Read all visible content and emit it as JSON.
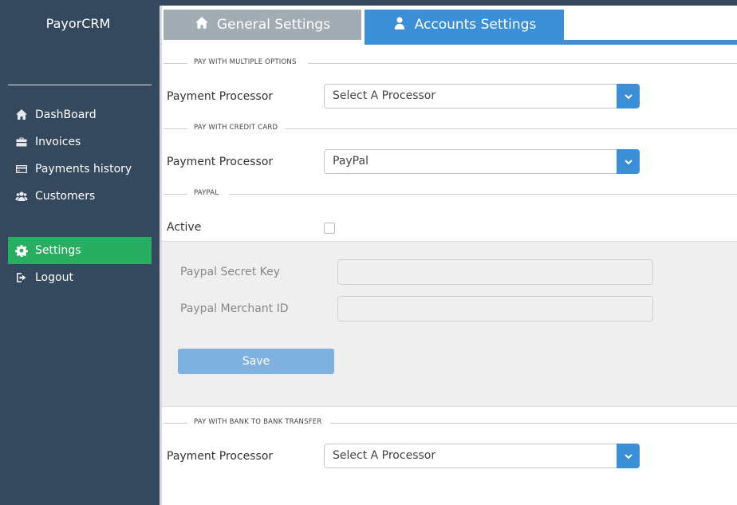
{
  "app": {
    "brand": "PayorCRM"
  },
  "sidebar": {
    "items": [
      {
        "label": "DashBoard",
        "icon": "home-icon"
      },
      {
        "label": "Invoices",
        "icon": "briefcase-icon"
      },
      {
        "label": "Payments history",
        "icon": "credit-card-icon"
      },
      {
        "label": "Customers",
        "icon": "users-icon"
      },
      {
        "label": "Settings",
        "icon": "gear-icon",
        "active": true
      },
      {
        "label": "Logout",
        "icon": "logout-icon"
      }
    ]
  },
  "tabs": [
    {
      "label": "General Settings",
      "icon": "home-icon"
    },
    {
      "label": "Accounts Settings",
      "icon": "user-icon",
      "active": true
    }
  ],
  "sections": {
    "multiple": {
      "title": "PAY WITH MULTIPLE OPTIONS",
      "label": "Payment Processor",
      "value": "Select A Processor"
    },
    "credit": {
      "title": "PAY WITH CREDIT CARD",
      "label": "Payment Processor",
      "value": "PayPal"
    },
    "paypal": {
      "title": "PAYPAL",
      "active_label": "Active",
      "active": false,
      "secret_key_label": "Paypal Secret Key",
      "secret_key_value": "",
      "merchant_id_label": "Paypal Merchant ID",
      "merchant_id_value": "",
      "save_label": "Save"
    },
    "bank": {
      "title": "PAY WITH BANK TO BANK TRANSFER",
      "label": "Payment Processor",
      "value": "Select A Processor"
    }
  },
  "colors": {
    "sidebar_bg": "#34495e",
    "active_green": "#27ae60",
    "accent_blue": "#3a8fd6",
    "inactive_tab": "#a2acb3",
    "save_button": "#7fb2de"
  }
}
